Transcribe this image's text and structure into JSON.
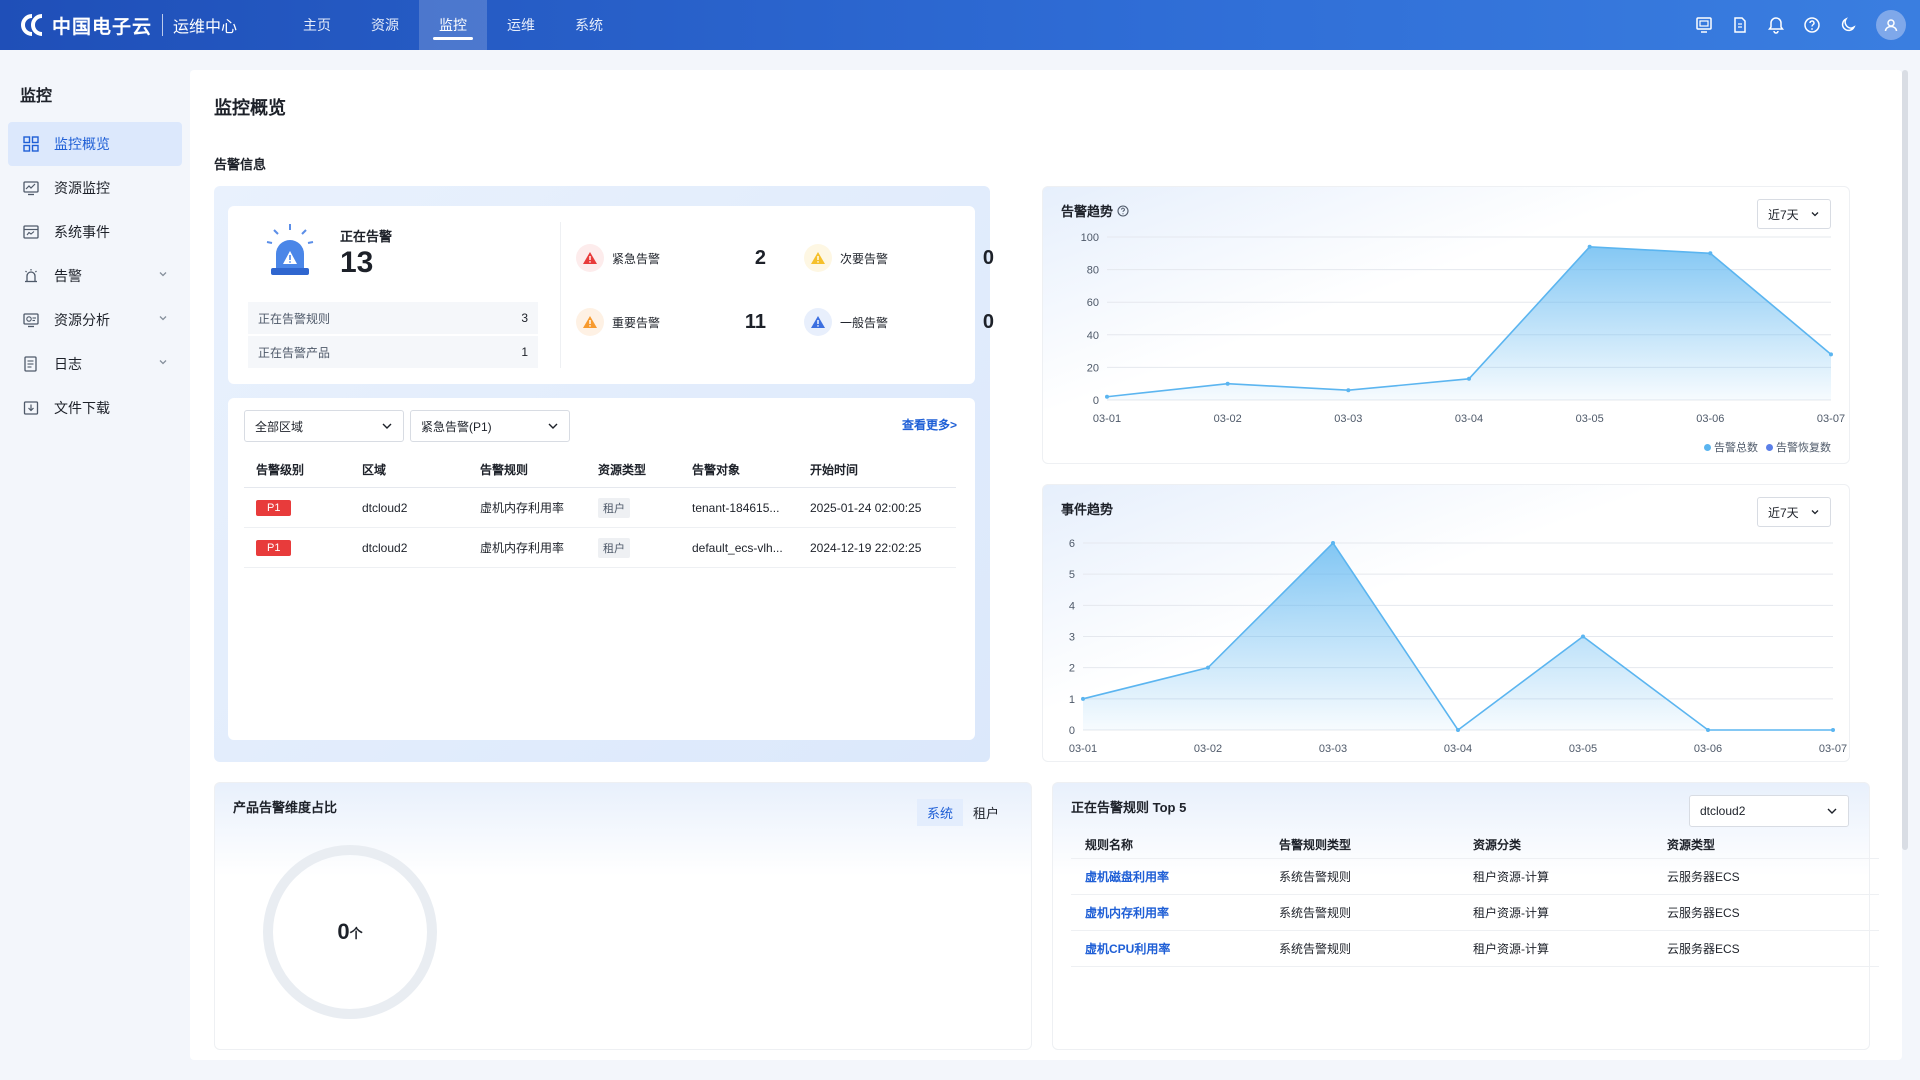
{
  "app": {
    "brand": "中国电子云",
    "subtitle": "运维中心",
    "nav": [
      "主页",
      "资源",
      "监控",
      "运维",
      "系统"
    ],
    "active_nav": "监控",
    "top_icons": [
      "screen-icon",
      "document-icon",
      "bell-icon",
      "help-icon",
      "moon-icon",
      "user-icon"
    ]
  },
  "sidebar": {
    "title": "监控",
    "items": [
      {
        "label": "监控概览",
        "icon": "grid-icon",
        "active": true,
        "expandable": false
      },
      {
        "label": "资源监控",
        "icon": "monitor-icon",
        "active": false,
        "expandable": false
      },
      {
        "label": "系统事件",
        "icon": "event-icon",
        "active": false,
        "expandable": false
      },
      {
        "label": "告警",
        "icon": "alarm-icon",
        "active": false,
        "expandable": true
      },
      {
        "label": "资源分析",
        "icon": "analysis-icon",
        "active": false,
        "expandable": true
      },
      {
        "label": "日志",
        "icon": "log-icon",
        "active": false,
        "expandable": true
      },
      {
        "label": "文件下载",
        "icon": "download-icon",
        "active": false,
        "expandable": false
      }
    ]
  },
  "page": {
    "title": "监控概览",
    "section_title": "告警信息"
  },
  "alert_summary": {
    "label": "正在告警",
    "value": "13",
    "rules_label": "正在告警规则",
    "rules_value": "3",
    "products_label": "正在告警产品",
    "products_value": "1",
    "severities": [
      {
        "label": "紧急告警",
        "value": "2",
        "color": "#e83b3b"
      },
      {
        "label": "次要告警",
        "value": "0",
        "color": "#f5c02b"
      },
      {
        "label": "重要告警",
        "value": "11",
        "color": "#f79a2e"
      },
      {
        "label": "一般告警",
        "value": "0",
        "color": "#3c6fe0"
      }
    ]
  },
  "alert_list": {
    "region_select": "全部区域",
    "level_select": "紧急告警(P1)",
    "more": "查看更多>",
    "columns": [
      "告警级别",
      "区域",
      "告警规则",
      "资源类型",
      "告警对象",
      "开始时间"
    ],
    "rows": [
      {
        "level": "P1",
        "region": "dtcloud2",
        "rule": "虚机内存利用率",
        "type": "租户",
        "object": "tenant-184615...",
        "time": "2025-01-24 02:00:25"
      },
      {
        "level": "P1",
        "region": "dtcloud2",
        "rule": "虚机内存利用率",
        "type": "租户",
        "object": "default_ecs-vlh...",
        "time": "2024-12-19 22:02:25"
      }
    ]
  },
  "alert_trend": {
    "title": "告警趋势",
    "range": "近7天",
    "legend": [
      "告警总数",
      "告警恢复数"
    ],
    "colors": {
      "total": "#5bb5f0",
      "recovered": "#5b7fe8"
    }
  },
  "event_trend": {
    "title": "事件趋势",
    "range": "近7天"
  },
  "product_ratio": {
    "title": "产品告警维度占比",
    "tabs": [
      "系统",
      "租户"
    ],
    "active_tab": "系统",
    "value": "0",
    "unit": "个"
  },
  "top_rules": {
    "title": "正在告警规则 Top 5",
    "region": "dtcloud2",
    "columns": [
      "规则名称",
      "告警规则类型",
      "资源分类",
      "资源类型"
    ],
    "rows": [
      {
        "name": "虚机磁盘利用率",
        "type": "系统告警规则",
        "category": "租户资源-计算",
        "resource": "云服务器ECS"
      },
      {
        "name": "虚机内存利用率",
        "type": "系统告警规则",
        "category": "租户资源-计算",
        "resource": "云服务器ECS"
      },
      {
        "name": "虚机CPU利用率",
        "type": "系统告警规则",
        "category": "租户资源-计算",
        "resource": "云服务器ECS"
      }
    ]
  },
  "chart_data": [
    {
      "type": "area",
      "title": "告警趋势",
      "categories": [
        "03-01",
        "03-02",
        "03-03",
        "03-04",
        "03-05",
        "03-06",
        "03-07"
      ],
      "series": [
        {
          "name": "告警总数",
          "values": [
            2,
            10,
            6,
            13,
            94,
            90,
            28
          ]
        },
        {
          "name": "告警恢复数",
          "values": [
            0,
            0,
            0,
            0,
            0,
            0,
            0
          ]
        }
      ],
      "ylim": [
        0,
        100
      ],
      "yticks": [
        0,
        20,
        40,
        60,
        80,
        100
      ],
      "grid": true,
      "legend": "bottom-right"
    },
    {
      "type": "area",
      "title": "事件趋势",
      "categories": [
        "03-01",
        "03-02",
        "03-03",
        "03-04",
        "03-05",
        "03-06",
        "03-07"
      ],
      "series": [
        {
          "values": [
            1,
            2,
            6,
            0,
            3,
            0,
            0
          ]
        }
      ],
      "ylim": [
        0,
        6
      ],
      "yticks": [
        0,
        1,
        2,
        3,
        4,
        5,
        6
      ],
      "grid": true
    }
  ]
}
